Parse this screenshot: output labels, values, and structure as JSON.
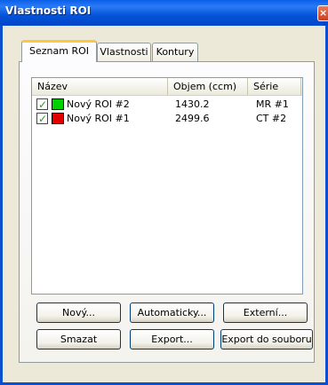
{
  "window": {
    "title": "Vlastnosti ROI",
    "close_glyph": "×"
  },
  "tabs": [
    {
      "label": "Seznam ROI",
      "active": true
    },
    {
      "label": "Vlastnosti",
      "active": false
    },
    {
      "label": "Kontury",
      "active": false
    }
  ],
  "list": {
    "columns": [
      "Název",
      "Objem (ccm)",
      "Série"
    ],
    "rows": [
      {
        "checked": true,
        "check_glyph": "✓",
        "color": "#00d000",
        "name": "Nový ROI #2",
        "volume": "1430.2",
        "series": "MR #1"
      },
      {
        "checked": true,
        "check_glyph": "✓",
        "color": "#e00000",
        "name": "Nový ROI #1",
        "volume": "2499.6",
        "series": "CT #2"
      }
    ]
  },
  "buttons": {
    "new": "Nový...",
    "auto": "Automaticky...",
    "external": "Externí...",
    "delete": "Smazat",
    "export": "Export...",
    "export_file": "Export do souboru"
  }
}
